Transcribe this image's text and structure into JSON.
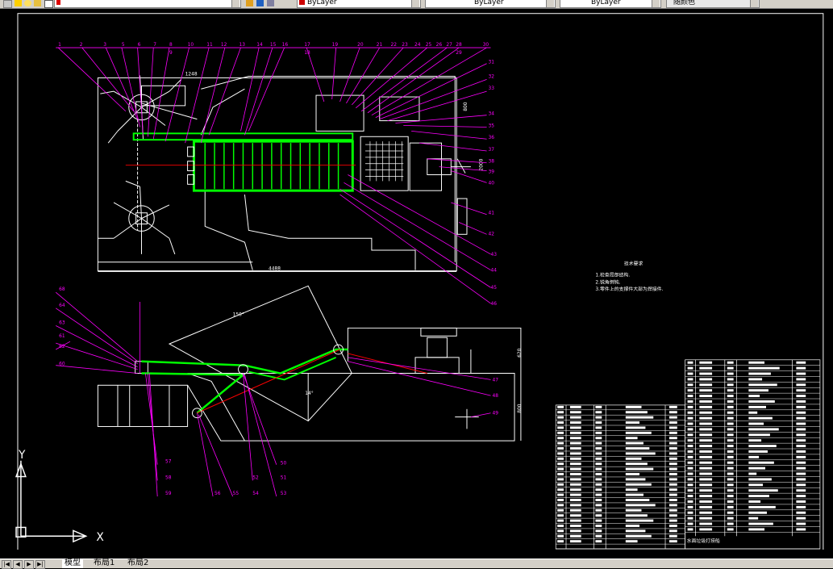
{
  "toolbar": {
    "combo_first": "",
    "combo_color": "ByLayer",
    "combo_linetype": "ByLayer",
    "combo_lineweight": "ByLayer",
    "combo_plotstyle": "随颜色"
  },
  "drawing": {
    "plan_dims": {
      "width_top": "1248",
      "width_bottom": "4488",
      "height_right": "800",
      "height_right2": "2000"
    },
    "plan_labels_top": [
      "1",
      "2",
      "3",
      "5",
      "6",
      "7",
      "8",
      "9",
      "10",
      "11",
      "12",
      "13",
      "14",
      "15",
      "16",
      "17",
      "18",
      "19",
      "20",
      "21",
      "22",
      "23",
      "24",
      "25",
      "26",
      "27",
      "28",
      "29",
      "30"
    ],
    "plan_labels_right": [
      "31",
      "32",
      "33",
      "34",
      "35",
      "36",
      "37",
      "38",
      "39",
      "40",
      "41",
      "42",
      "43",
      "44",
      "45",
      "46"
    ],
    "elev_labels_left": [
      "68",
      "64",
      "63",
      "61",
      "62",
      "60"
    ],
    "elev_labels_bottom": [
      "57",
      "58",
      "59",
      "56",
      "55",
      "54",
      "52",
      "51",
      "50",
      "53"
    ],
    "elev_labels_right": [
      "47",
      "48",
      "49"
    ],
    "elev_dims": {
      "angle_top": "150°",
      "angle_mid": "14°",
      "height_right": "620",
      "height_right2": "800"
    },
    "tech_title": "技术要求",
    "tech_lines": [
      "1.检查局部结构.",
      "2.锐角倒钝.",
      "3.零件上的支撑件大部为焊接件."
    ],
    "title_block_label": "水面垃圾打捞船",
    "ucs": {
      "x": "X",
      "y": "Y"
    }
  },
  "colors": {
    "green": "#00ff00",
    "magenta": "#ff00ff",
    "red": "#ff0000",
    "white": "#ffffff",
    "bg": "#000000"
  },
  "tabs": {
    "model": "模型",
    "layout1": "布局1",
    "layout2": "布局2"
  }
}
